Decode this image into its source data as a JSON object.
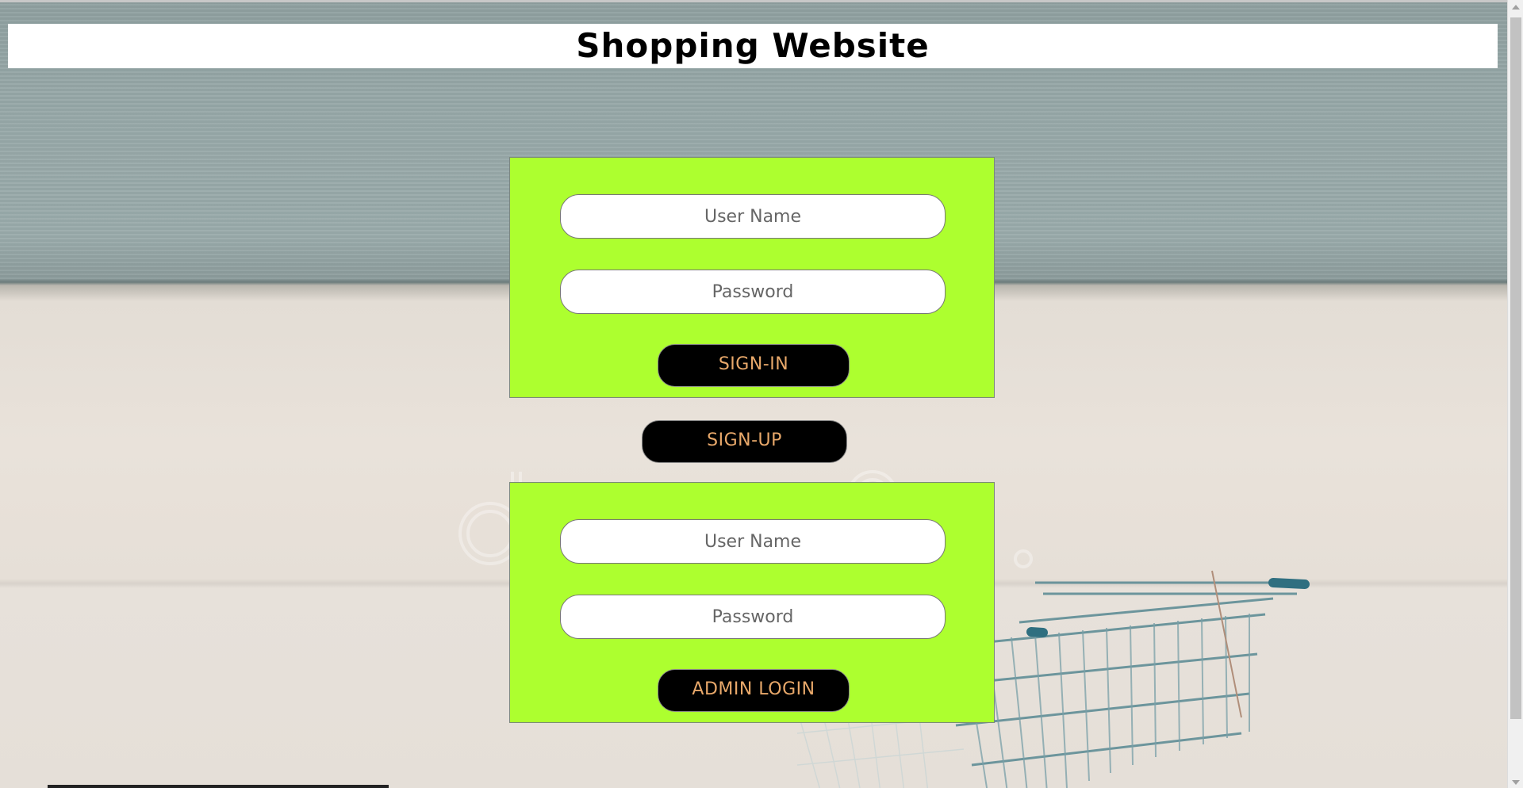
{
  "header": {
    "title": "Shopping Website"
  },
  "login_form": {
    "username_placeholder": "User Name",
    "password_placeholder": "Password",
    "submit_label": "SIGN-IN"
  },
  "signup": {
    "label": "SIGN-UP"
  },
  "admin_form": {
    "username_placeholder": "User Name",
    "password_placeholder": "Password",
    "submit_label": "ADMIN LOGIN"
  },
  "colors": {
    "panel_bg": "#adff2f",
    "button_bg": "#000000",
    "button_text": "#e8a86a",
    "header_bg": "#ffffff"
  },
  "icons": {
    "background_image": "shopping-cart-image",
    "watermark": "dreamstime-watermark"
  }
}
